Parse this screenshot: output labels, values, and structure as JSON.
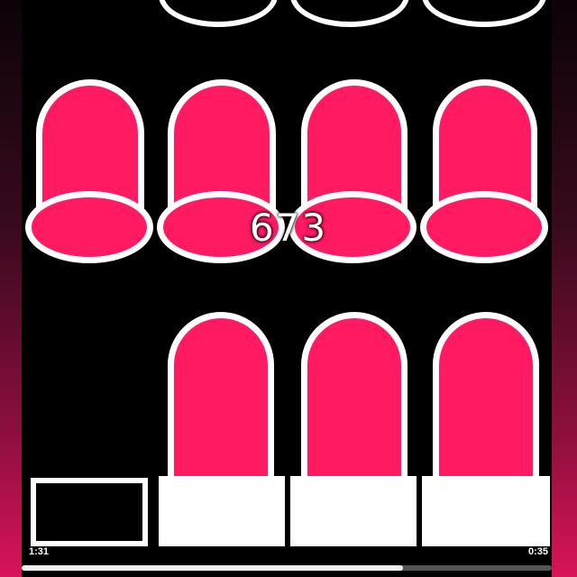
{
  "game": {
    "score": "673",
    "time_elapsed": "1:31",
    "time_remaining": "0:35",
    "progress_fraction": 0.72,
    "lanes": 4
  },
  "colors": {
    "tile": "#ff1a62",
    "outline": "#ffffff",
    "board": "#000000"
  }
}
